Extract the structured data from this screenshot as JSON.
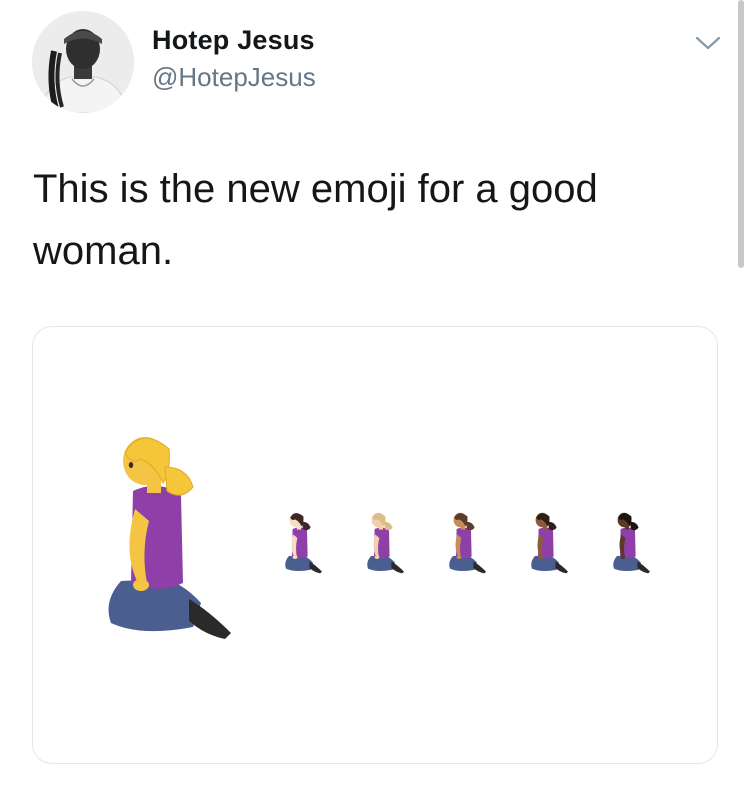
{
  "tweet": {
    "author": {
      "display_name": "Hotep Jesus",
      "handle": "@HotepJesus"
    },
    "text": "This is the new emoji for a good woman.",
    "media": {
      "figures": [
        {
          "size": "large",
          "hair": "#f6c63a",
          "skin": "#f4c544"
        },
        {
          "size": "small",
          "hair": "#3b2a23",
          "skin": "#f8dcc4"
        },
        {
          "size": "small",
          "hair": "#d9bf86",
          "skin": "#f3cfae"
        },
        {
          "size": "small",
          "hair": "#5a3d2b",
          "skin": "#c58c5c"
        },
        {
          "size": "small",
          "hair": "#2e1f18",
          "skin": "#8d5a3b"
        },
        {
          "size": "small",
          "hair": "#1f1510",
          "skin": "#5b3a27"
        }
      ]
    }
  },
  "colors": {
    "text_primary": "#14171a",
    "text_secondary": "#657786",
    "card_border": "#e1e8ed",
    "shirt": "#8e3fa8",
    "jeans": "#4a5e8f"
  },
  "icons": {
    "menu": "chevron-down-icon",
    "avatar": "profile-photo"
  }
}
